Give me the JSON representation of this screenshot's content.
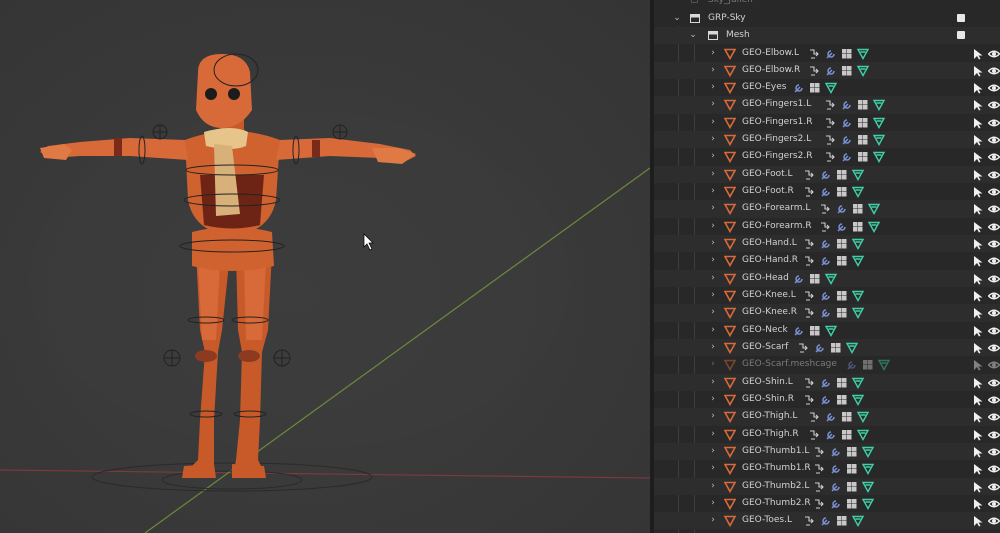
{
  "outliner": {
    "top_partial_item": "Sky_julien",
    "collection_label": "GRP-Sky",
    "sub_collection_label": "Mesh",
    "items": [
      {
        "name": "GEO-Elbow.L",
        "chain": true,
        "child": true
      },
      {
        "name": "GEO-Elbow.R",
        "chain": true,
        "child": true
      },
      {
        "name": "GEO-Eyes",
        "chain": false,
        "child": false
      },
      {
        "name": "GEO-Fingers1.L",
        "chain": true,
        "child": true
      },
      {
        "name": "GEO-Fingers1.R",
        "chain": true,
        "child": true
      },
      {
        "name": "GEO-Fingers2.L",
        "chain": true,
        "child": true
      },
      {
        "name": "GEO-Fingers2.R",
        "chain": true,
        "child": true
      },
      {
        "name": "GEO-Foot.L",
        "chain": true,
        "child": true
      },
      {
        "name": "GEO-Foot.R",
        "chain": true,
        "child": true
      },
      {
        "name": "GEO-Forearm.L",
        "chain": true,
        "child": true
      },
      {
        "name": "GEO-Forearm.R",
        "chain": true,
        "child": true
      },
      {
        "name": "GEO-Hand.L",
        "chain": true,
        "child": true
      },
      {
        "name": "GEO-Hand.R",
        "chain": true,
        "child": true
      },
      {
        "name": "GEO-Head",
        "chain": false,
        "child": false
      },
      {
        "name": "GEO-Knee.L",
        "chain": true,
        "child": true
      },
      {
        "name": "GEO-Knee.R",
        "chain": true,
        "child": true
      },
      {
        "name": "GEO-Neck",
        "chain": false,
        "child": false
      },
      {
        "name": "GEO-Scarf",
        "chain": true,
        "child": false
      },
      {
        "name": "GEO-Scarf.meshcage",
        "chain": false,
        "child": true,
        "muted": true
      },
      {
        "name": "GEO-Shin.L",
        "chain": true,
        "child": true
      },
      {
        "name": "GEO-Shin.R",
        "chain": true,
        "child": true
      },
      {
        "name": "GEO-Thigh.L",
        "chain": true,
        "child": true
      },
      {
        "name": "GEO-Thigh.R",
        "chain": true,
        "child": true
      },
      {
        "name": "GEO-Thumb1.L",
        "chain": true,
        "child": true
      },
      {
        "name": "GEO-Thumb1.R",
        "chain": true,
        "child": true
      },
      {
        "name": "GEO-Thumb2.L",
        "chain": true,
        "child": true
      },
      {
        "name": "GEO-Thumb2.R",
        "chain": true,
        "child": true
      },
      {
        "name": "GEO-Toes.L",
        "chain": true,
        "child": true
      }
    ],
    "icons": {
      "object": "mesh-object-icon",
      "parent": "parent-chain-icon",
      "modifier": "wrench-modifier-icon",
      "vgroup": "vertex-groups-icon",
      "data": "mesh-data-icon",
      "select": "selectable-arrow-icon",
      "visibility": "eye-icon"
    }
  },
  "colors": {
    "mesh_orange": "#d86a3a",
    "modifier_blue": "#7a93d6",
    "data_green": "#3fd0a8",
    "viewport_bg": "#393939",
    "axis_green": "#6f8a3e",
    "axis_red": "#8c3c44"
  }
}
